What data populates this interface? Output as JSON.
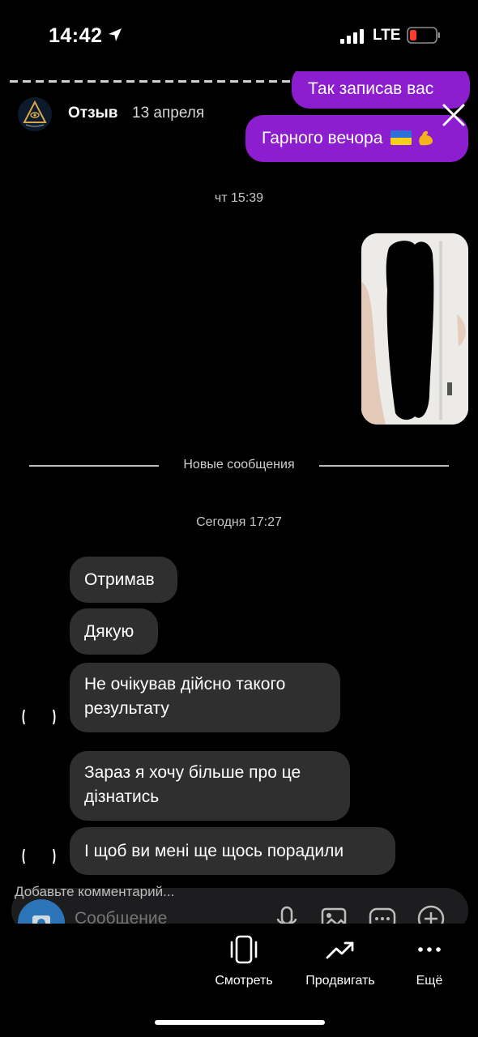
{
  "status_bar": {
    "time": "14:42",
    "network": "LTE"
  },
  "story": {
    "author": "Отзыв",
    "date": "13 апреля"
  },
  "chat": {
    "outgoing_top_cut": "Так записав вас",
    "outgoing_greeting": "Гарного вечора",
    "timestamp_1": "чт 15:39",
    "new_messages_label": "Новые сообщения",
    "timestamp_2": "Сегодня 17:27",
    "incoming": [
      "Отримав",
      "Дякую",
      "Не очікував дійсно такого результату",
      "Зараз я хочу більше про це дізнатись",
      "І щоб ви мені ще щось порадили"
    ]
  },
  "composer": {
    "prompt": "Добавьте комментарий...",
    "placeholder": "Сообщение"
  },
  "toolbar": {
    "view_label": "Смотреть",
    "promote_label": "Продвигать",
    "more_label": "Ещё"
  },
  "colors": {
    "outgoing_bubble": "#8c1ecf",
    "incoming_bubble": "#2f2f2f",
    "background": "#000000",
    "battery_low": "#ff3b30"
  },
  "icons": [
    "location-arrow-icon",
    "signal-icon",
    "battery-icon",
    "close-icon",
    "microphone-icon",
    "gallery-icon",
    "sticker-icon",
    "plus-icon",
    "view-icon",
    "promote-icon",
    "more-icon"
  ]
}
